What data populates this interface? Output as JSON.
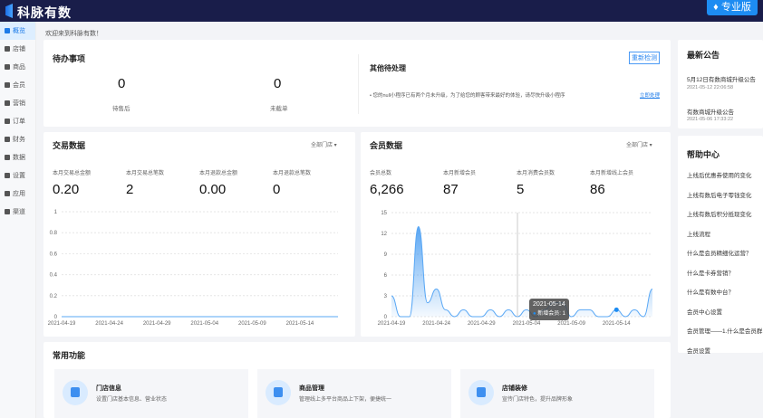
{
  "header": {
    "brand": "科脉有数",
    "pro_badge": "专业版"
  },
  "sidebar": {
    "items": [
      {
        "label": "概览",
        "active": true
      },
      {
        "label": "店铺"
      },
      {
        "label": "商品"
      },
      {
        "label": "会员"
      },
      {
        "label": "营销"
      },
      {
        "label": "订单"
      },
      {
        "label": "财务"
      },
      {
        "label": "数据"
      },
      {
        "label": "设置"
      },
      {
        "label": "应用"
      },
      {
        "label": "渠道"
      }
    ]
  },
  "welcome": "欢迎来到科脉有数！",
  "todo": {
    "title": "待办事项",
    "items": [
      {
        "value": "0",
        "label": "待售后"
      },
      {
        "value": "0",
        "label": "未截单"
      }
    ]
  },
  "other": {
    "title": "其他待处理",
    "recheck": "重新检测",
    "notice": "您的null小程序已有两个月未升级，为了给您的顾客带来最好的体验，请尽快升级小程序",
    "action": "立即处理"
  },
  "trade": {
    "title": "交易数据",
    "store_select": "全部门店",
    "stats": [
      {
        "label": "本月交易总金额",
        "value": "0.20"
      },
      {
        "label": "本月交易总笔数",
        "value": "2"
      },
      {
        "label": "本月退款总金额",
        "value": "0.00"
      },
      {
        "label": "本月退款总笔数",
        "value": "0"
      }
    ]
  },
  "member": {
    "title": "会员数据",
    "store_select": "全部门店",
    "stats": [
      {
        "label": "会员总数",
        "value": "6,266"
      },
      {
        "label": "本月新增会员",
        "value": "87"
      },
      {
        "label": "本月消费会员数",
        "value": "5"
      },
      {
        "label": "本月新增线上会员",
        "value": "86"
      }
    ],
    "tooltip": {
      "date": "2021-05-14",
      "text": "新增会员: 1"
    }
  },
  "chart_data": [
    {
      "type": "line",
      "title": "交易数据",
      "x_ticks": [
        "2021-04-19",
        "2021-04-24",
        "2021-04-29",
        "2021-05-04",
        "2021-05-09",
        "2021-05-14"
      ],
      "y_ticks": [
        "0",
        "0.2",
        "0.4",
        "0.6",
        "0.8",
        "1"
      ],
      "ylim": [
        0,
        1
      ],
      "values": [
        0,
        0,
        0,
        0,
        0,
        0,
        0,
        0,
        0,
        0,
        0,
        0,
        0,
        0,
        0,
        0,
        0,
        0,
        0,
        0,
        0,
        0,
        0,
        0,
        0,
        0,
        0,
        0,
        0,
        0
      ]
    },
    {
      "type": "area",
      "title": "会员数据",
      "series_name": "新增会员",
      "x_ticks": [
        "2021-04-19",
        "2021-04-24",
        "2021-04-29",
        "2021-05-04",
        "2021-05-09",
        "2021-05-14"
      ],
      "y_ticks": [
        "0",
        "3",
        "6",
        "9",
        "12",
        "15"
      ],
      "ylim": [
        0,
        15
      ],
      "values": [
        3,
        0,
        0,
        13,
        2,
        4,
        1,
        0,
        1,
        0,
        0,
        1,
        0,
        1,
        0,
        1,
        0,
        1,
        2,
        2,
        0,
        1,
        1,
        0,
        0,
        1,
        0,
        1,
        0,
        4
      ]
    }
  ],
  "notices": {
    "title": "最新公告",
    "items": [
      {
        "title": "5月12日有数商城升级公告",
        "date": "2021-05-12 22:06:58"
      },
      {
        "title": "有数商城升级公告",
        "date": "2021-05-06 17:33:22"
      }
    ]
  },
  "help": {
    "title": "帮助中心",
    "items": [
      "上线后优惠券使用的变化",
      "上线有数后电子零钱变化",
      "上线有数后积分抵现变化",
      "上线流程",
      "什么是会员精细化运营？",
      "什么是卡券营销？",
      "什么是有数中台？",
      "会员中心设置",
      "会员管理——1.什么是会员群",
      "会员设置"
    ]
  },
  "functions": {
    "title": "常用功能",
    "items": [
      {
        "title": "门店信息",
        "desc": "设置门店基本信息、营业状态"
      },
      {
        "title": "商品管理",
        "desc": "管理线上多平台商品上下架，便捷统一"
      },
      {
        "title": "店铺装修",
        "desc": "宣传门店特色，提升品牌形象"
      }
    ]
  }
}
